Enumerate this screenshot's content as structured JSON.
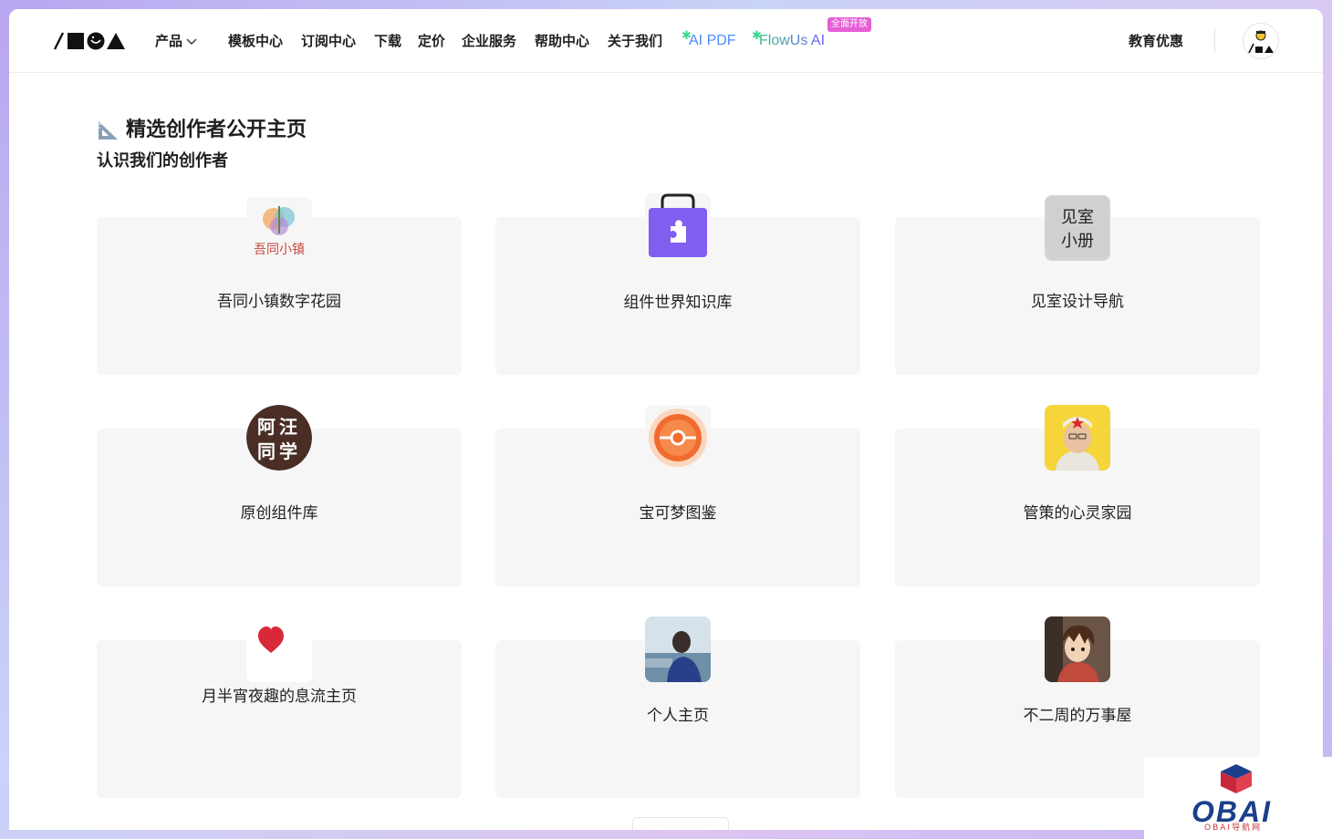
{
  "header": {
    "logo_alt": "/MOA",
    "nav": [
      {
        "label": "产品",
        "has_dropdown": true
      },
      {
        "label": "模板中心"
      },
      {
        "label": "订阅中心"
      },
      {
        "label": "下载"
      },
      {
        "label": "定价"
      },
      {
        "label": "企业服务"
      },
      {
        "label": "帮助中心"
      },
      {
        "label": "关于我们"
      }
    ],
    "ai_pdf": "AI PDF",
    "flowus_ai": "FlowUs AI",
    "badge": "全面开放",
    "education": "教育优惠"
  },
  "section": {
    "title": "精选创作者公开主页",
    "subtitle": "认识我们的创作者"
  },
  "cards": [
    {
      "label": "吾同小镇数字花园",
      "icon": "wutong-town-logo"
    },
    {
      "label": "组件世界知识库",
      "icon": "purple-bag-puzzle-icon"
    },
    {
      "label": "见室设计导航",
      "icon": "jianshi-xiaoce-logo",
      "icon_text_1": "见室",
      "icon_text_2": "小册"
    },
    {
      "label": "原创组件库",
      "icon": "awang-classmate-logo",
      "icon_text_1": "阿汪",
      "icon_text_2": "同学"
    },
    {
      "label": "宝可梦图鉴",
      "icon": "pokeball-icon"
    },
    {
      "label": "管策的心灵家园",
      "icon": "portrait-avatar"
    },
    {
      "label": "月半宵夜趣的息流主页",
      "icon": "red-heart-icon"
    },
    {
      "label": "个人主页",
      "icon": "person-photo-avatar"
    },
    {
      "label": "不二周的万事屋",
      "icon": "anime-avatar"
    }
  ],
  "watermark": {
    "text": "OBAI",
    "sub": "OBAI导航网"
  },
  "colors": {
    "accent_blue": "#4a8cff",
    "accent_green": "#3dd68c",
    "badge_pink": "#e55fd6",
    "card_bg": "#f6f6f6"
  }
}
